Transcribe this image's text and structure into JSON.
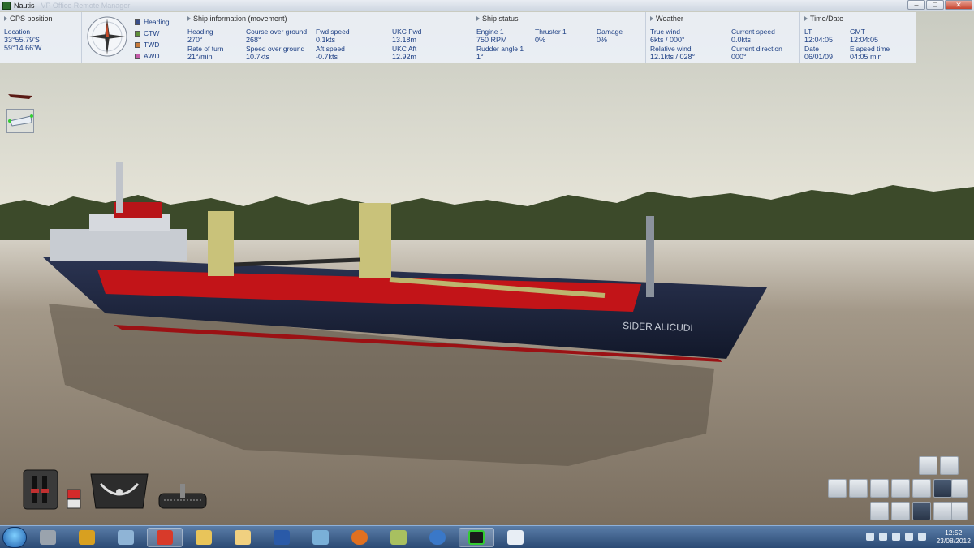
{
  "window": {
    "title": "Nautis",
    "subtitle": "VP Office Remote Manager"
  },
  "colors": {
    "hull": "#1f2740",
    "deck_red": "#c21418",
    "crane": "#c9c27a",
    "water": "#8a7f70"
  },
  "hud": {
    "gps": {
      "title": "GPS position",
      "location_label": "Location",
      "lat": "33°55.79'S",
      "lon": "59°14.66'W"
    },
    "compass": {
      "legend": [
        {
          "label": "Heading",
          "color": "#3a4f8a"
        },
        {
          "label": "CTW",
          "color": "#5f8f3a"
        },
        {
          "label": "TWD",
          "color": "#c87a3a"
        },
        {
          "label": "AWD",
          "color": "#c45aa8"
        }
      ]
    },
    "movement": {
      "title": "Ship information (movement)",
      "items": [
        {
          "label": "Heading",
          "value": "270°"
        },
        {
          "label": "Course over ground",
          "value": "268°"
        },
        {
          "label": "Fwd speed",
          "value": "0.1kts"
        },
        {
          "label": "UKC Fwd",
          "value": "13.18m"
        },
        {
          "label": "Rate of turn",
          "value": "21°/min"
        },
        {
          "label": "Speed over ground",
          "value": "10.7kts"
        },
        {
          "label": "Aft speed",
          "value": "-0.7kts"
        },
        {
          "label": "UKC Aft",
          "value": "12.92m"
        }
      ]
    },
    "status": {
      "title": "Ship status",
      "items": [
        {
          "label": "Engine 1",
          "value": "750 RPM"
        },
        {
          "label": "Thruster 1",
          "value": "0%"
        },
        {
          "label": "Damage",
          "value": "0%"
        },
        {
          "label": "Rudder angle 1",
          "value": "1°"
        }
      ]
    },
    "weather": {
      "title": "Weather",
      "items": [
        {
          "label": "True wind",
          "value": "6kts / 000°"
        },
        {
          "label": "Current speed",
          "value": "0.0kts"
        },
        {
          "label": "Relative wind",
          "value": "12.1kts / 028°"
        },
        {
          "label": "Current direction",
          "value": "000°"
        }
      ]
    },
    "time": {
      "title": "Time/Date",
      "items": [
        {
          "label": "LT",
          "value": "12:04:05"
        },
        {
          "label": "GMT",
          "value": "12:04:05"
        },
        {
          "label": "Date",
          "value": "06/01/09"
        },
        {
          "label": "Elapsed time",
          "value": "04:05 min"
        }
      ]
    }
  },
  "ship": {
    "name": "SIDER ALICUDI"
  },
  "taskbar": {
    "time": "12:52",
    "date": "23/08/2012"
  }
}
